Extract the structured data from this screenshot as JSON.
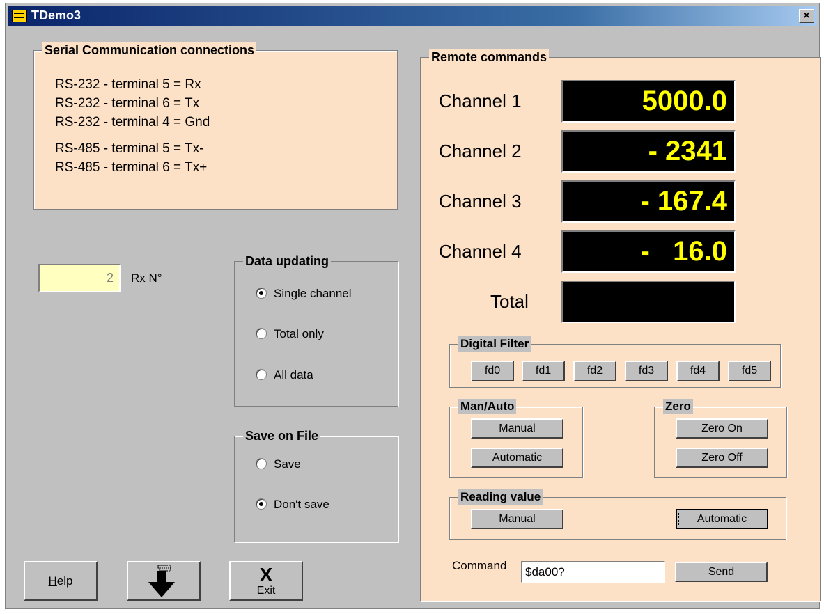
{
  "window": {
    "title": "TDemo3",
    "close_label": "×"
  },
  "serial": {
    "title": "Serial Communication connections",
    "lines": [
      "RS-232  - terminal 5 = Rx",
      "RS-232  - terminal 6 = Tx",
      "RS-232  - terminal 4 = Gnd",
      "RS-485  - terminal 5 = Tx-",
      "RS-485  - terminal 6 = Tx+"
    ]
  },
  "rx": {
    "value": "2",
    "label": "Rx N°"
  },
  "data_updating": {
    "title": "Data updating",
    "options": [
      "Single channel",
      "Total only",
      "All data"
    ],
    "selected": 0
  },
  "save_on_file": {
    "title": "Save on File",
    "options": [
      "Save",
      "Don't save"
    ],
    "selected": 1
  },
  "buttons": {
    "help": "Help",
    "exit": "Exit",
    "exit_icon": "X"
  },
  "remote": {
    "title": "Remote commands",
    "channels": [
      {
        "label": "Channel 1",
        "value": "5000.0"
      },
      {
        "label": "Channel 2",
        "value": "- 2341"
      },
      {
        "label": "Channel 3",
        "value": "- 167.4"
      },
      {
        "label": "Channel 4",
        "value": "-   16.0"
      },
      {
        "label": "Total",
        "value": ""
      }
    ],
    "digital_filter": {
      "title": "Digital Filter",
      "buttons": [
        "fd0",
        "fd1",
        "fd2",
        "fd3",
        "fd4",
        "fd5"
      ]
    },
    "man_auto": {
      "title": "Man/Auto",
      "manual": "Manual",
      "automatic": "Automatic"
    },
    "zero": {
      "title": "Zero",
      "on": "Zero On",
      "off": "Zero Off"
    },
    "reading_value": {
      "title": "Reading value",
      "manual": "Manual",
      "automatic": "Automatic"
    },
    "command": {
      "label": "Command",
      "value": "$da00?",
      "send": "Send"
    }
  },
  "colors": {
    "display_bg": "#000000",
    "display_text": "#ffff00",
    "panel": "#fde1c6",
    "field": "#ffffc0"
  }
}
